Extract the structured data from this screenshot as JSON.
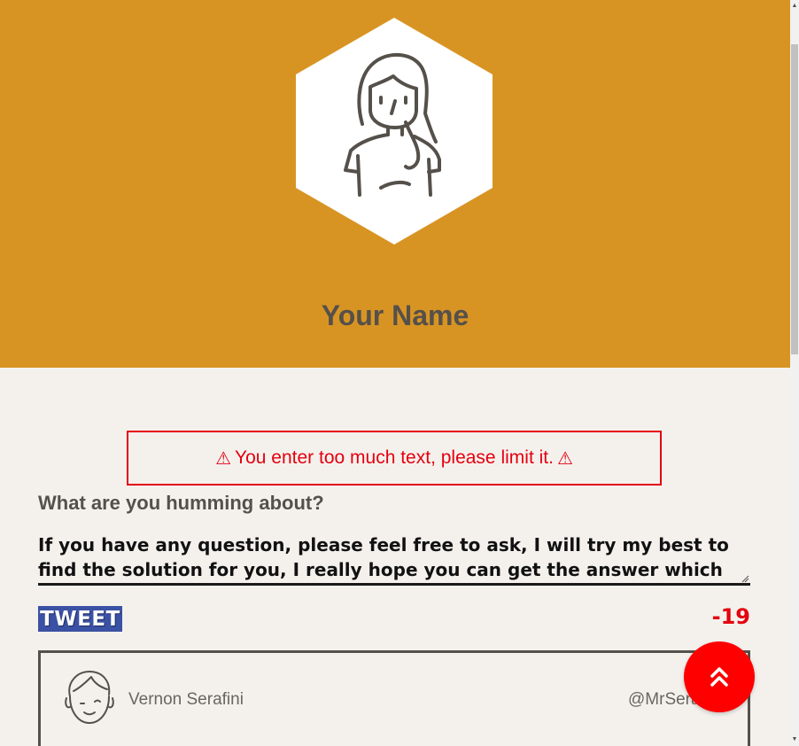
{
  "profile": {
    "name": "Your Name",
    "avatar_icon": "woman-avatar-icon"
  },
  "error": {
    "message": "You enter too much text, please limit it.",
    "warning_glyph": "⚠"
  },
  "composer": {
    "label": "What are you humming about?",
    "value": "If you have any question, please feel free to ask, I will try my best to find the solution for you, I really hope you can get the answer which works for you",
    "tweet_label": "TWEET",
    "remaining": "-19"
  },
  "tweets": [
    {
      "author": "Vernon Serafini",
      "handle": "@MrSerafini"
    }
  ],
  "colors": {
    "header_bg": "#d89423",
    "page_bg": "#f4f1ed",
    "error": "#e4000f",
    "tweet_button": "#3b51a3",
    "fab": "#ff0000"
  }
}
